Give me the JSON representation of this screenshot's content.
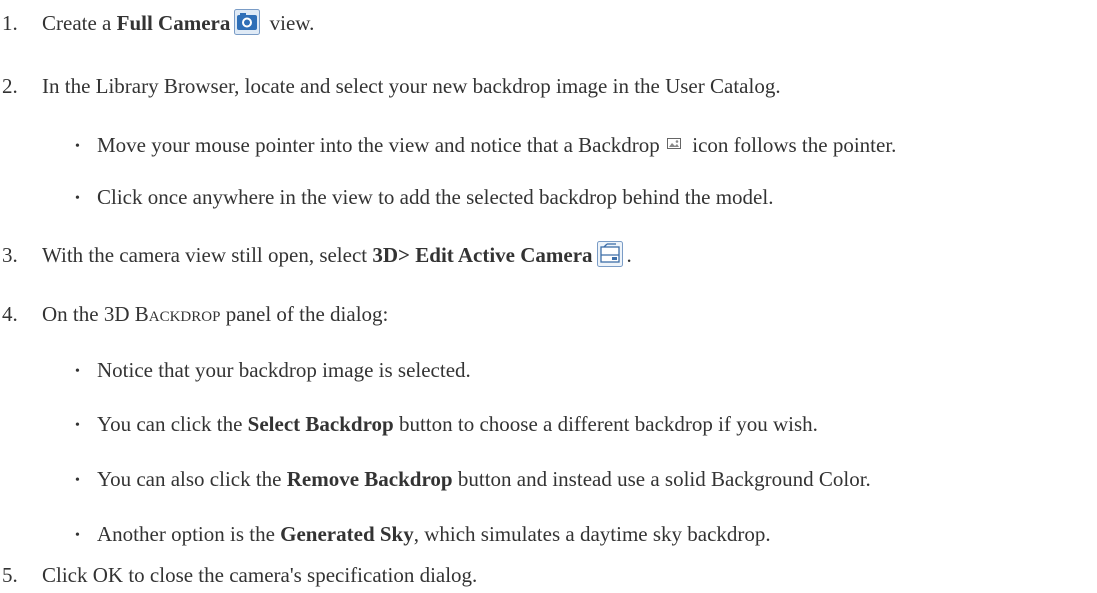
{
  "steps": [
    {
      "number": "1.",
      "pre": "Create a ",
      "bold": "Full Camera",
      "post": " view.",
      "icon": "full-camera-icon"
    },
    {
      "number": "2.",
      "text": "In the Library Browser, locate and select your new backdrop image in the User Catalog.",
      "bullets": [
        {
          "pre": "Move your mouse pointer into the view and notice that a Backdrop ",
          "post": " icon follows the pointer.",
          "icon": "backdrop-icon"
        },
        {
          "text": "Click once anywhere in the view to add the selected backdrop behind the model."
        }
      ]
    },
    {
      "number": "3.",
      "pre": "With the camera view still open, select ",
      "bold": "3D> Edit Active Camera",
      "post": ".",
      "icon": "edit-active-camera-icon"
    },
    {
      "number": "4.",
      "pre": "On the 3D B",
      "smallcaps": "ACKDROP",
      "post": " panel of the dialog:",
      "bullets": [
        {
          "text": "Notice that your backdrop image is selected."
        },
        {
          "pre": "You can click the ",
          "bold": "Select Backdrop",
          "post": " button to choose a different backdrop if you wish."
        },
        {
          "pre": "You can also click the ",
          "bold": "Remove Backdrop",
          "post": " button and instead use a solid Background Color."
        },
        {
          "pre": "Another option is the ",
          "bold": "Generated Sky",
          "post": ", which simulates a daytime sky backdrop."
        }
      ]
    },
    {
      "number": "5.",
      "text": "Click OK to close the camera's specification dialog."
    }
  ],
  "bullet_glyph": "•",
  "colors": {
    "text": "#333333",
    "icon_border": "#7a9cc6",
    "icon_fill": "#2f6fb7",
    "icon_bg": "#dfeaf6"
  }
}
